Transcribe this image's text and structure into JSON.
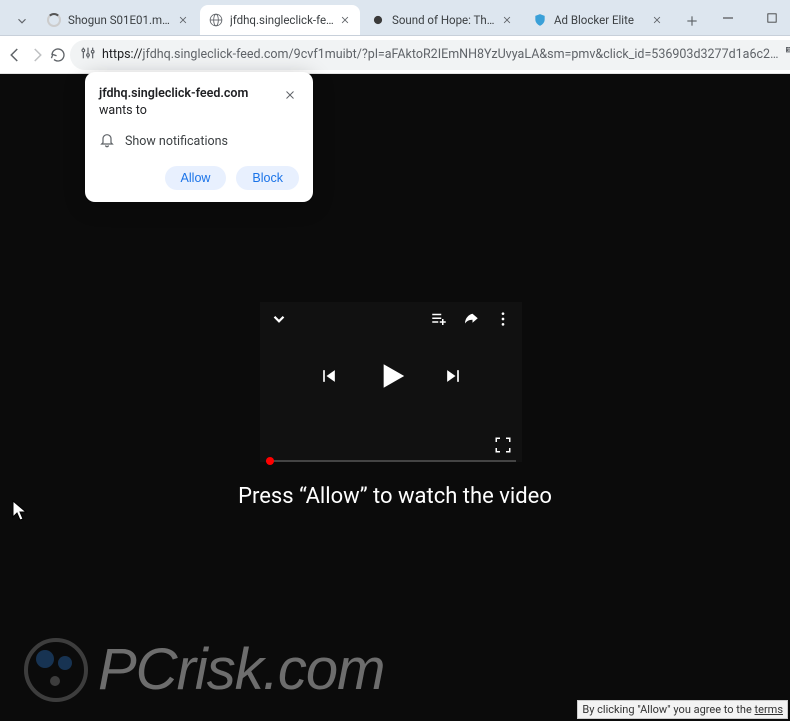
{
  "tabs": [
    {
      "title": "Shogun S01E01.mp4",
      "favicon": "spinner"
    },
    {
      "title": "jfdhq.singleclick-feed.com/",
      "favicon": "globe",
      "active": true
    },
    {
      "title": "Sound of Hope: The Story",
      "favicon": "globe-dark"
    },
    {
      "title": "Ad Blocker Elite",
      "favicon": "shield"
    }
  ],
  "address": {
    "scheme": "https://",
    "url": "jfdhq.singleclick-feed.com/9cvf1muibt/?pl=aFAktoR2IEmNH8YzUvyaLA&sm=pmv&click_id=536903d3277d1a6c2…"
  },
  "permission": {
    "site": "jfdhq.singleclick-feed.com",
    "wants": "wants to",
    "capability": "Show notifications",
    "allow": "Allow",
    "block": "Block"
  },
  "player": {
    "hint": "Press “Allow” to watch the video"
  },
  "watermark": {
    "text": "PCrisk.com"
  },
  "disclaimer": {
    "prefix": "By clicking \"Allow\" you agree to the ",
    "link": "terms"
  }
}
